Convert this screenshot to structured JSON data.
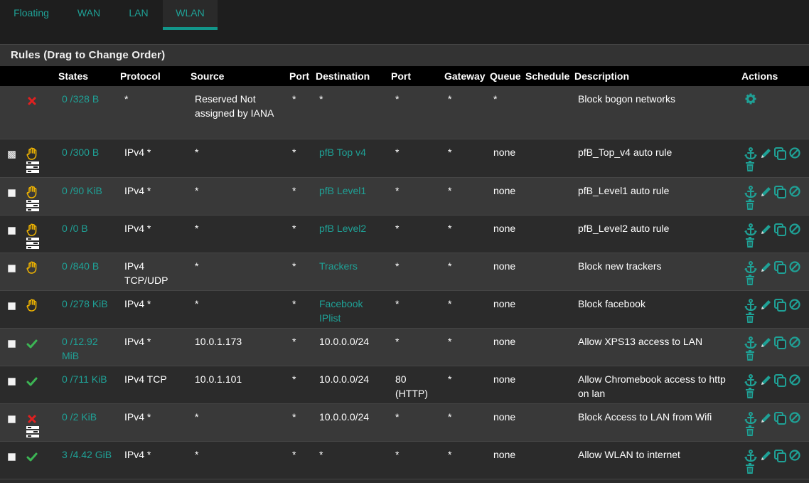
{
  "tabs": [
    {
      "label": "Floating"
    },
    {
      "label": "WAN"
    },
    {
      "label": "LAN"
    },
    {
      "label": "WLAN"
    }
  ],
  "panel": {
    "title": "Rules (Drag to Change Order)"
  },
  "columns": {
    "states": "States",
    "protocol": "Protocol",
    "source": "Source",
    "sport": "Port",
    "destination": "Destination",
    "dport": "Port",
    "gateway": "Gateway",
    "queue": "Queue",
    "schedule": "Schedule",
    "description": "Description",
    "actions": "Actions"
  },
  "rules": [
    {
      "states": "0 /328 B",
      "protocol": "*",
      "source": "Reserved Not assigned by IANA",
      "sport": "*",
      "destination": "*",
      "dport": "*",
      "gateway": "*",
      "queue": "*",
      "description": "Block bogon networks",
      "action": "block"
    },
    {
      "states": "0 /300 B",
      "protocol": "IPv4 *",
      "source": "*",
      "sport": "*",
      "destination": "pfB Top v4",
      "dport": "*",
      "gateway": "*",
      "queue": "none",
      "description": "pfB_Top_v4 auto rule",
      "action": "reject"
    },
    {
      "states": "0 /90 KiB",
      "protocol": "IPv4 *",
      "source": "*",
      "sport": "*",
      "destination": "pfB Level1",
      "dport": "*",
      "gateway": "*",
      "queue": "none",
      "description": "pfB_Level1 auto rule",
      "action": "reject"
    },
    {
      "states": "0 /0 B",
      "protocol": "IPv4 *",
      "source": "*",
      "sport": "*",
      "destination": "pfB Level2",
      "dport": "*",
      "gateway": "*",
      "queue": "none",
      "description": "pfB_Level2 auto rule",
      "action": "reject"
    },
    {
      "states": "0 /840 B",
      "protocol": "IPv4 TCP/UDP",
      "source": "*",
      "sport": "*",
      "destination": "Trackers",
      "dport": "*",
      "gateway": "*",
      "queue": "none",
      "description": "Block new trackers",
      "action": "reject"
    },
    {
      "states": "0 /278 KiB",
      "protocol": "IPv4 *",
      "source": "*",
      "sport": "*",
      "destination": "Facebook IPlist",
      "dport": "*",
      "gateway": "*",
      "queue": "none",
      "description": "Block facebook",
      "action": "reject"
    },
    {
      "states": "0 /12.92 MiB",
      "protocol": "IPv4 *",
      "source": "10.0.1.173",
      "sport": "*",
      "destination": "10.0.0.0/24",
      "dport": "*",
      "gateway": "*",
      "queue": "none",
      "description": "Allow XPS13 access to LAN",
      "action": "pass"
    },
    {
      "states": "0 /711 KiB",
      "protocol": "IPv4 TCP",
      "source": "10.0.1.101",
      "sport": "*",
      "destination": "10.0.0.0/24",
      "dport": "80 (HTTP)",
      "gateway": "*",
      "queue": "none",
      "description": "Allow Chromebook access to http on lan",
      "action": "pass"
    },
    {
      "states": "0 /2 KiB",
      "protocol": "IPv4 *",
      "source": "*",
      "sport": "*",
      "destination": "10.0.0.0/24",
      "dport": "*",
      "gateway": "*",
      "queue": "none",
      "description": "Block Access to LAN from Wifi",
      "action": "block"
    },
    {
      "states": "3 /4.42 GiB",
      "protocol": "IPv4 *",
      "source": "*",
      "sport": "*",
      "destination": "*",
      "dport": "*",
      "gateway": "*",
      "queue": "none",
      "description": "Allow WLAN to internet",
      "action": "pass"
    }
  ],
  "colors": {
    "accent": "#1fa196",
    "reject": "#f0b400",
    "block": "#e02020",
    "pass": "#3cb554"
  }
}
